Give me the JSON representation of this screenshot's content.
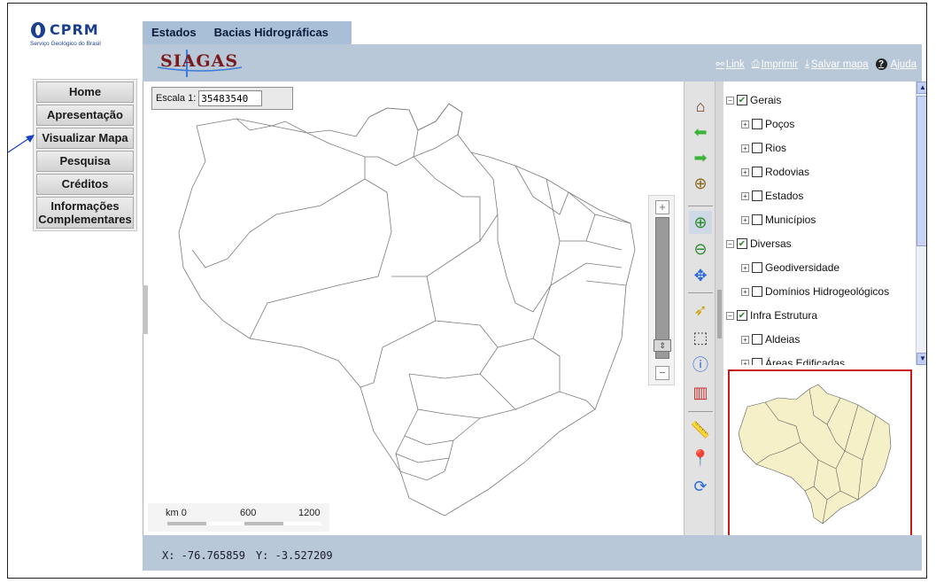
{
  "logo": {
    "brand": "CPRM",
    "subtitle": "Serviço Geológico do Brasil"
  },
  "tabs": [
    {
      "label": "Estados"
    },
    {
      "label": "Bacias Hidrográficas"
    }
  ],
  "nav": [
    {
      "label": "Home"
    },
    {
      "label": "Apresentação"
    },
    {
      "label": "Visualizar Mapa"
    },
    {
      "label": "Pesquisa"
    },
    {
      "label": "Créditos"
    },
    {
      "label": "Informações Complementares"
    }
  ],
  "header": {
    "app_logo": "SIAGAS",
    "links": {
      "link": "Link",
      "print": "Imprimir",
      "save": "Salvar mapa",
      "help": "Ajuda"
    }
  },
  "map": {
    "scale_label": "Escala 1:",
    "scale_value": "35483540",
    "scalebar": {
      "labels": [
        "km 0",
        "600",
        "1200"
      ]
    }
  },
  "toolbar_icons": [
    "home-icon",
    "back-arrow-icon",
    "forward-arrow-icon",
    "full-extent-icon",
    "zoom-in-icon",
    "zoom-out-icon",
    "pan-icon",
    "identify-icon",
    "select-icon",
    "info-icon",
    "legend-icon",
    "measure-icon",
    "marker-icon",
    "refresh-icon"
  ],
  "layers": [
    {
      "label": "Gerais",
      "checked": true,
      "level": 0
    },
    {
      "label": "Poços",
      "checked": false,
      "level": 1
    },
    {
      "label": "Rios",
      "checked": false,
      "level": 1
    },
    {
      "label": "Rodovias",
      "checked": false,
      "level": 1
    },
    {
      "label": "Estados",
      "checked": false,
      "level": 1
    },
    {
      "label": "Municípios",
      "checked": false,
      "level": 1
    },
    {
      "label": "Diversas",
      "checked": true,
      "level": 0
    },
    {
      "label": "Geodiversidade",
      "checked": false,
      "level": 1
    },
    {
      "label": "Domínios Hidrogeológicos",
      "checked": false,
      "level": 1
    },
    {
      "label": "Infra Estrutura",
      "checked": true,
      "level": 0
    },
    {
      "label": "Aldeias",
      "checked": false,
      "level": 1
    },
    {
      "label": "Áreas Edificadas",
      "checked": false,
      "level": 1
    }
  ],
  "status": {
    "x": "X: -76.765859",
    "y": "Y: -3.527209"
  },
  "colors": {
    "header_bg": "#b9c8d8",
    "tabs_bg": "#a9bfd8",
    "overview_border": "#cc1a1a",
    "overview_fill": "#f6f0c8"
  }
}
